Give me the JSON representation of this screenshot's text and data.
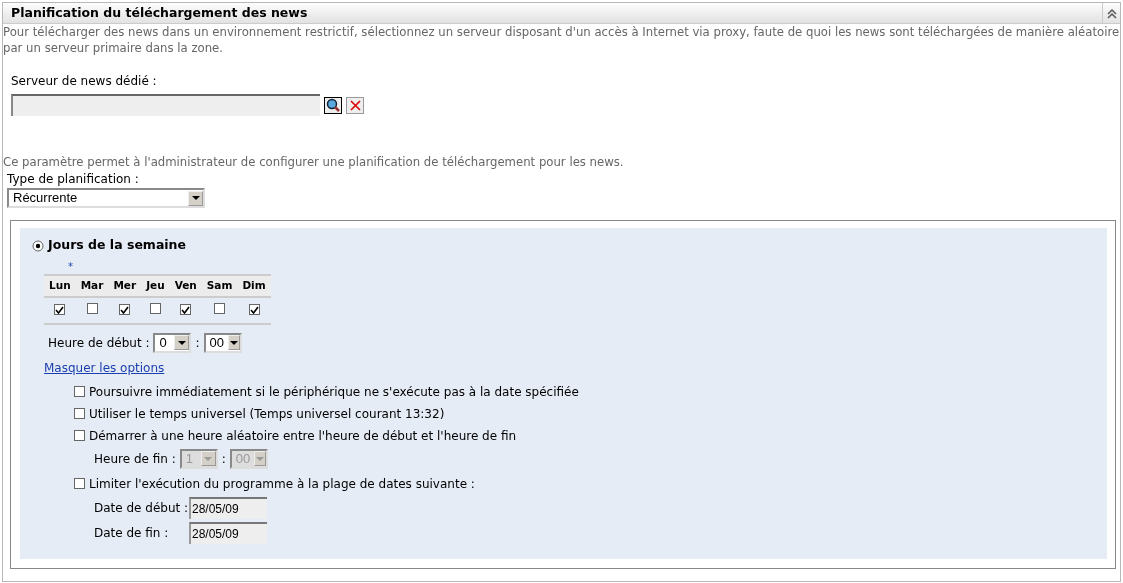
{
  "panel": {
    "title": "Planification du téléchargement des news",
    "expanded": true
  },
  "description": "Pour télécharger des news dans un environnement restrictif, sélectionnez un serveur disposant d'un accès à Internet via proxy, faute de quoi les news sont téléchargées de manière aléatoire par un serveur primaire dans la zone.",
  "server_field": {
    "label": "Serveur de news dédié :"
  },
  "schedule_description": "Ce paramètre permet à l'administrateur de configurer une planification de téléchargement pour les news.",
  "schedule_type": {
    "label": "Type de planification :",
    "value": "Récurrente"
  },
  "weekdays": {
    "label": "Jours de la semaine",
    "selected": true,
    "required_mark": "*",
    "days": [
      {
        "label": "Lun",
        "checked": true
      },
      {
        "label": "Mar",
        "checked": false
      },
      {
        "label": "Mer",
        "checked": true
      },
      {
        "label": "Jeu",
        "checked": false
      },
      {
        "label": "Ven",
        "checked": true
      },
      {
        "label": "Sam",
        "checked": false
      },
      {
        "label": "Dim",
        "checked": true
      }
    ],
    "start_time": {
      "label": "Heure de début :",
      "hour": "0",
      "separator": ":",
      "minute": "00"
    },
    "options_link": "Masquer les options",
    "options": [
      {
        "label": "Poursuivre immédiatement si le périphérique ne s'exécute pas à la date spécifiée",
        "checked": false
      },
      {
        "label": "Utiliser le temps universel (Temps universel courant 13:32)",
        "checked": false
      },
      {
        "label": "Démarrer à une heure aléatoire entre l'heure de début et l'heure de fin",
        "checked": false,
        "end_time": {
          "label": "Heure de fin :",
          "hour": "1",
          "separator": ":",
          "minute": "00",
          "disabled": true
        }
      },
      {
        "label": "Limiter l'exécution du programme à la plage de dates suivante :",
        "checked": false,
        "dates": [
          {
            "label": "Date de début :",
            "value": "28/05/09"
          },
          {
            "label": "Date de fin :",
            "value": "28/05/09"
          }
        ]
      }
    ]
  }
}
